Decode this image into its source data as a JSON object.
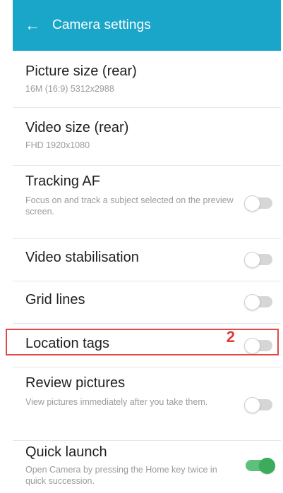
{
  "appbar": {
    "back_glyph": "←",
    "title": "Camera settings",
    "color": "#1aa6c9"
  },
  "items": [
    {
      "title": "Picture size (rear)",
      "subtitle": "16M (16:9) 5312x2988",
      "toggle": null
    },
    {
      "title": "Video size (rear)",
      "subtitle": "FHD 1920x1080",
      "toggle": null
    },
    {
      "title": "Tracking AF",
      "subtitle": "Focus on and track a subject selected on the preview screen.",
      "toggle": "off"
    },
    {
      "title": "Video stabilisation",
      "subtitle": "",
      "toggle": "off"
    },
    {
      "title": "Grid lines",
      "subtitle": "",
      "toggle": "off"
    },
    {
      "title": "Location tags",
      "subtitle": "",
      "toggle": "off"
    },
    {
      "title": "Review pictures",
      "subtitle": "View pictures immediately after you take them.",
      "toggle": "off"
    },
    {
      "title": "Quick launch",
      "subtitle": "Open Camera by pressing the Home key twice in quick succession.",
      "toggle": "on"
    }
  ],
  "annotation": {
    "step_number": "2",
    "highlight_color": "#e04a4a"
  },
  "colors": {
    "toggle_on": "#3cab5c",
    "toggle_off": "#d6d6d6"
  }
}
